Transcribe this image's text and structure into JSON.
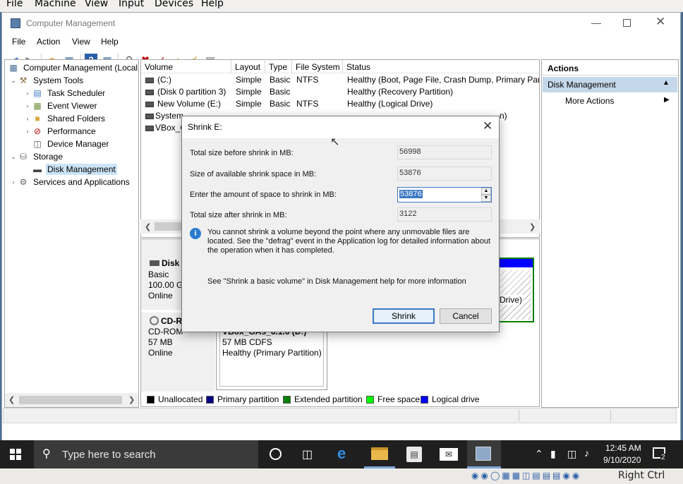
{
  "host_menu": [
    "File",
    "Machine",
    "View",
    "Input",
    "Devices",
    "Help"
  ],
  "window": {
    "title": "Computer Management",
    "menu": [
      "File",
      "Action",
      "View",
      "Help"
    ]
  },
  "tree": {
    "root": "Computer Management (Local",
    "system_tools": "System Tools",
    "task_scheduler": "Task Scheduler",
    "event_viewer": "Event Viewer",
    "shared_folders": "Shared Folders",
    "performance": "Performance",
    "device_manager": "Device Manager",
    "storage": "Storage",
    "disk_management": "Disk Management",
    "services": "Services and Applications"
  },
  "volume_list": {
    "headers": [
      "Volume",
      "Layout",
      "Type",
      "File System",
      "Status"
    ],
    "rows": [
      {
        "volume": "(C:)",
        "layout": "Simple",
        "type": "Basic",
        "fs": "NTFS",
        "status": "Healthy (Boot, Page File, Crash Dump, Primary Part"
      },
      {
        "volume": "(Disk 0 partition 3)",
        "layout": "Simple",
        "type": "Basic",
        "fs": "",
        "status": "Healthy (Recovery Partition)"
      },
      {
        "volume": "New Volume (E:)",
        "layout": "Simple",
        "type": "Basic",
        "fs": "NTFS",
        "status": "Healthy (Logical Drive)"
      },
      {
        "volume": "System",
        "layout": "",
        "type": "",
        "fs": "",
        "status": "n)"
      },
      {
        "volume": "VBox_G",
        "layout": "",
        "type": "",
        "fs": "",
        "status": ""
      }
    ]
  },
  "disks": {
    "disk0": {
      "name": "Disk 0",
      "type": "Basic",
      "size": "100.00 GB",
      "state": "Online",
      "partition_tail": "Drive)"
    },
    "cdrom": {
      "name": "CD-ROM 0",
      "type": "CD-ROM",
      "size": "57 MB",
      "state": "Online",
      "vol_name": "VBox_GAs_6.1.6  (D:)",
      "vol_size": "57 MB CDFS",
      "vol_status": "Healthy (Primary Partition)"
    }
  },
  "legend": [
    {
      "label": "Unallocated",
      "color": "#000000"
    },
    {
      "label": "Primary partition",
      "color": "#000080"
    },
    {
      "label": "Extended partition",
      "color": "#008000"
    },
    {
      "label": "Free space",
      "color": "#00ff00"
    },
    {
      "label": "Logical drive",
      "color": "#0000ff"
    }
  ],
  "actions": {
    "header": "Actions",
    "section": "Disk Management",
    "more": "More Actions"
  },
  "dialog": {
    "title": "Shrink E:",
    "total_before_label": "Total size before shrink in MB:",
    "total_before_value": "56998",
    "available_label": "Size of available shrink space in MB:",
    "available_value": "53876",
    "enter_label": "Enter the amount of space to shrink in MB:",
    "enter_value": "53876",
    "after_label": "Total size after shrink in MB:",
    "after_value": "3122",
    "info_text": "You cannot shrink a volume beyond the point where any unmovable files are located. See the \"defrag\" event in the Application log for detailed information about the operation when it has completed.",
    "help_text": "See \"Shrink a basic volume\" in Disk Management help for more information",
    "shrink_button": "Shrink",
    "cancel_button": "Cancel"
  },
  "taskbar": {
    "search_placeholder": "Type here to search",
    "time": "12:45 AM",
    "date": "9/10/2020",
    "notif_count": "2"
  },
  "host_status": {
    "right_ctrl": "Right Ctrl"
  }
}
